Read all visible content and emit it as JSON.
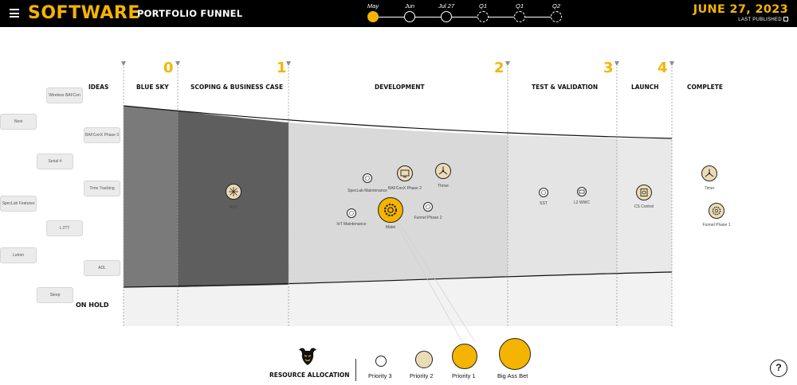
{
  "header": {
    "title": "SOFTWARE",
    "subtitle": "PORTFOLIO FUNNEL",
    "date": "JUNE 27, 2023",
    "last_published": "LAST PUBLISHED",
    "menu_icon": "hamburger-menu-icon",
    "timeline": [
      {
        "label": "May",
        "state": "active"
      },
      {
        "label": "Jun",
        "state": "solid"
      },
      {
        "label": "Jul 27",
        "state": "solid"
      },
      {
        "label": "Q1",
        "state": "dashed"
      },
      {
        "label": "Q1",
        "state": "dashed"
      },
      {
        "label": "Q2",
        "state": "dashed"
      }
    ]
  },
  "stages": {
    "ideas": "IDEAS",
    "blue_sky": "BLUE SKY",
    "scoping": "SCOPING & BUSINESS CASE",
    "development": "DEVELOPMENT",
    "test": "TEST & VALIDATION",
    "launch": "LAUNCH",
    "complete": "COMPLETE",
    "gate0": "0",
    "gate1": "1",
    "gate2": "2",
    "gate3": "3",
    "gate4": "4",
    "on_hold": "ON HOLD"
  },
  "ideas": {
    "wireless": "Wireless BAFCon",
    "nest": "Nest",
    "bafconx3": "BAFConX Phase 3",
    "serial": "Serial #",
    "time_tracking": "Time Tracking",
    "speclab_features": "SpecLab Features",
    "l2tt": "L 2TT",
    "lutron": "Lutron",
    "adl": "ADL",
    "sleep": "Sleep"
  },
  "projects": {
    "ndt": {
      "label": "NDT",
      "priority": "Priority 2",
      "icon": "starburst-icon"
    },
    "speclab_maint": {
      "label": "SpecLab Maintenance",
      "priority": "Priority 3",
      "icon": "gear-icon"
    },
    "bafconx2": {
      "label": "BAFConX Phase 2",
      "priority": "Priority 2",
      "icon": "monitor-icon"
    },
    "thrive": {
      "label": "Thrive",
      "priority": "Priority 2",
      "icon": "fan-icon"
    },
    "iot": {
      "label": "IoT Maintenance",
      "priority": "Priority 3",
      "icon": "gear-icon"
    },
    "matei": {
      "label": "Matei",
      "priority": "Priority 1",
      "icon": "gear-icon"
    },
    "funnel2": {
      "label": "Funnel Phase 2",
      "priority": "Priority 3",
      "icon": "gear-icon"
    },
    "sst": {
      "label": "SST",
      "priority": "Priority 3",
      "icon": "gear-icon"
    },
    "l2wwc": {
      "label": "L2 WWC",
      "priority": "Priority 3",
      "icon": "monitor-icon"
    },
    "cscontrol": {
      "label": "CS Control",
      "priority": "Priority 2",
      "icon": "panel-icon"
    },
    "timer": {
      "label": "Timer",
      "priority": "Priority 2",
      "icon": "fan-icon"
    },
    "funnel1": {
      "label": "Funnel Phase 1",
      "priority": "Priority 2",
      "icon": "gear-icon"
    }
  },
  "legend": {
    "title": "RESOURCE ALLOCATION",
    "p3": "Priority 3",
    "p2": "Priority 2",
    "p1": "Priority 1",
    "big": "Big Ass Bet",
    "logo": "bull-logo-icon"
  },
  "help": "?",
  "colors": {
    "accent": "#f5b400",
    "header_bg": "#000000",
    "blue_sky": "#7a7a7a",
    "scoping": "#5e5e5e",
    "development": "#d9d9d9",
    "test": "#e4e4e4",
    "launch": "#e9e9e9",
    "priority2": "#ecdcb6"
  }
}
